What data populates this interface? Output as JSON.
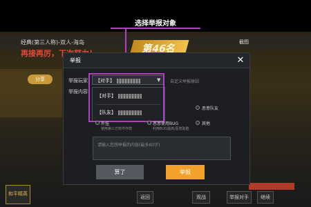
{
  "annotation": {
    "title": "选择举报对象",
    "accent_color": "#b240c4"
  },
  "background": {
    "mode_text": "经典(第三人称)-双人-海岛",
    "rank_text": "再接再厉，下次努力！",
    "badge_text": "第46名",
    "share_text": "截图",
    "pill_text": "分享",
    "flag_text": "",
    "logo_text": "和平精英",
    "bottom_buttons": [
      "返回",
      "观战",
      "举报对手",
      "继续"
    ]
  },
  "modal": {
    "title": "举报",
    "close_icon": "close-icon",
    "player_label": "举报玩家:",
    "selected_value": "【对手】",
    "hint_link": "自定义举报原因",
    "content_label": "举报内容:",
    "dropdown": [
      {
        "tag": "【对手】"
      },
      {
        "tag": "【队友】"
      }
    ],
    "options": [
      {
        "label": "恶意队友",
        "sub": ""
      },
      {
        "label": "外挂",
        "sub": "使用第三方软件作弊"
      },
      {
        "label": "恶意使用BUG",
        "sub": "利用BUG提高/恶意取胜"
      },
      {
        "label": "其他",
        "sub": ""
      }
    ],
    "textarea_placeholder": "请输入您想举报的内容(最多60字)",
    "cancel_label": "算了",
    "report_label": "举报",
    "report_color": "#f2a12a"
  }
}
